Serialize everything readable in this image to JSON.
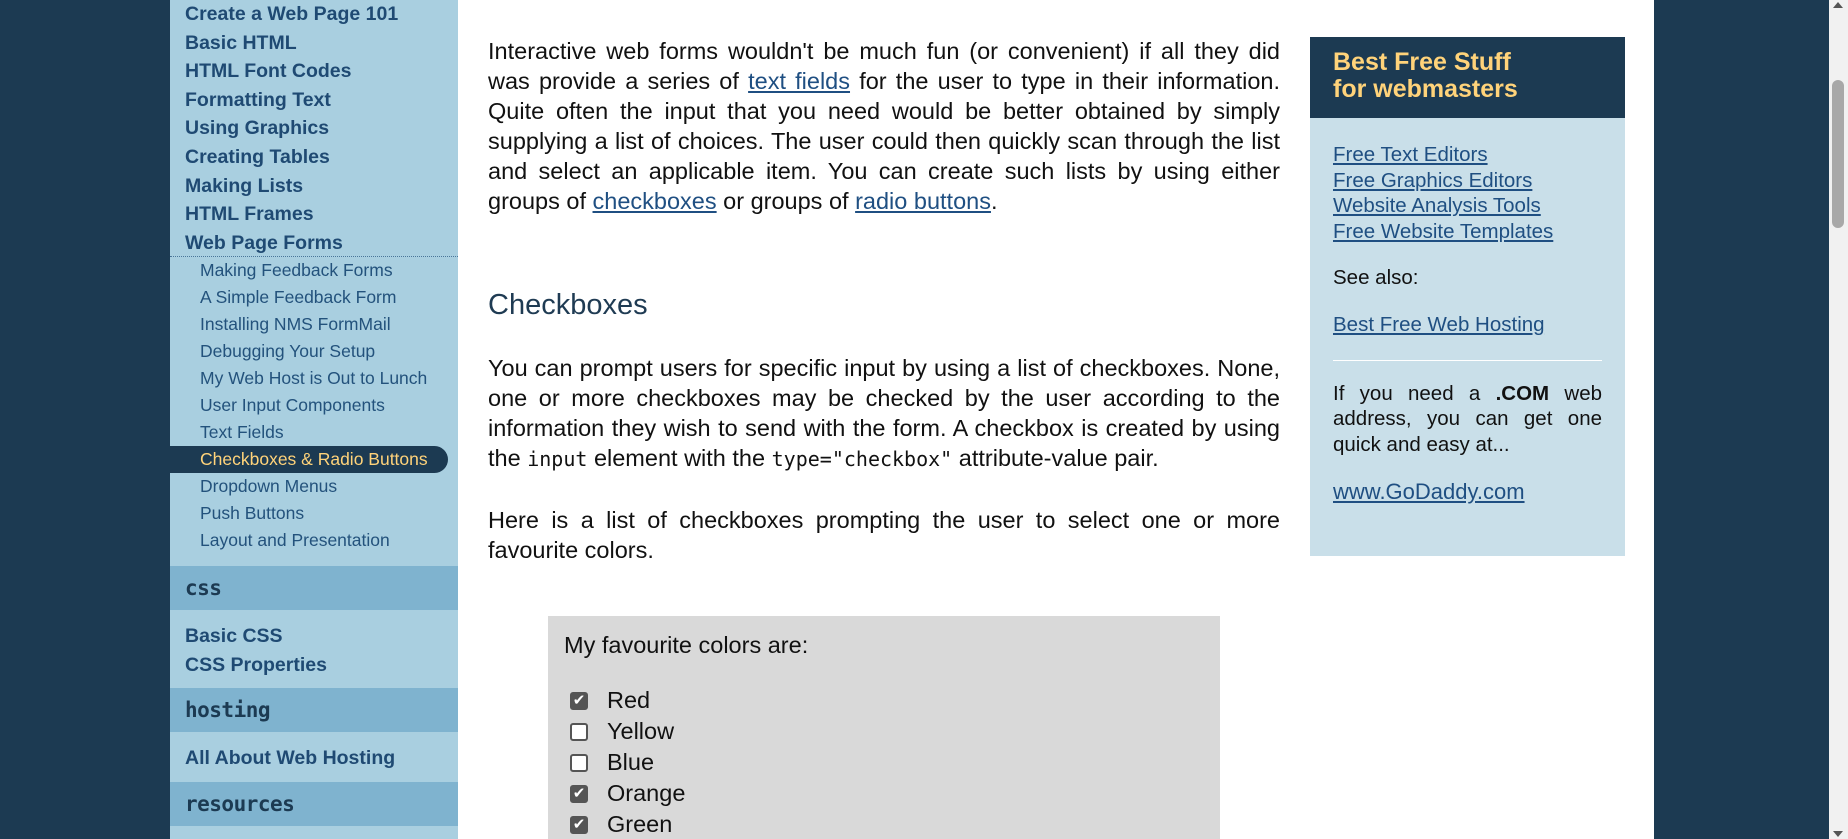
{
  "sidebar": {
    "html_links": [
      "Create a Web Page 101",
      "Basic HTML",
      "HTML Font Codes",
      "Formatting Text",
      "Using Graphics",
      "Creating Tables",
      "Making Lists",
      "HTML Frames",
      "Web Page Forms"
    ],
    "sub_links": [
      "Making Feedback Forms",
      "A Simple Feedback Form",
      "Installing NMS FormMail",
      "Debugging Your Setup",
      "My Web Host is Out to Lunch",
      "User Input Components",
      "Text Fields",
      "Checkboxes & Radio Buttons",
      "Dropdown Menus",
      "Push Buttons",
      "Layout and Presentation"
    ],
    "css_head": "css",
    "css_links": [
      "Basic CSS",
      "CSS Properties"
    ],
    "hosting_head": "hosting",
    "hosting_links": [
      "All About Web Hosting"
    ],
    "resources_head": "resources"
  },
  "content": {
    "p1_a": "Interactive web forms wouldn't be much fun (or convenient) if all they did was provide a series of ",
    "p1_link1": "text fields",
    "p1_b": " for the user to type in their information. Quite often the input that you need would be better obtained by simply supplying a list of choices. The user could then quickly scan through the list and select an applicable item. You can create such lists by using either groups of ",
    "p1_link2": "checkboxes",
    "p1_c": " or groups of ",
    "p1_link3": "radio buttons",
    "p1_d": ".",
    "heading": "Checkboxes",
    "p2_a": "You can prompt users for specific input by using a list of checkboxes. None, one or more checkboxes may be checked by the user according to the information they wish to send with the form. A checkbox is created by using the ",
    "p2_code1": "input",
    "p2_b": " element with the ",
    "p2_code2": "type=\"checkbox\"",
    "p2_c": " attribute-value pair.",
    "p3": "Here is a list of checkboxes prompting the user to select one or more favourite colors.",
    "form": {
      "legend": "My favourite colors are:",
      "options": [
        {
          "label": "Red",
          "checked": true
        },
        {
          "label": "Yellow",
          "checked": false
        },
        {
          "label": "Blue",
          "checked": false
        },
        {
          "label": "Orange",
          "checked": true
        },
        {
          "label": "Green",
          "checked": true
        }
      ]
    }
  },
  "rightbox": {
    "head_line1": "Best Free Stuff",
    "head_line2": "for webmasters",
    "links": [
      "Free Text Editors",
      "Free Graphics Editors",
      "Website Analysis Tools",
      "Free Website Templates"
    ],
    "see_also": "See also:",
    "hosting_link": "Best Free Web Hosting",
    "para_a": "If you need a ",
    "para_bold": ".COM",
    "para_b": " web address, you can get one quick and easy at...",
    "godaddy": "www.GoDaddy.com "
  },
  "colors": {
    "background": "#1c3a52",
    "sidebar": "#a9cfe0",
    "section_head": "#7fb3cf",
    "accent": "#ffd37a",
    "link": "#1f4f82"
  }
}
